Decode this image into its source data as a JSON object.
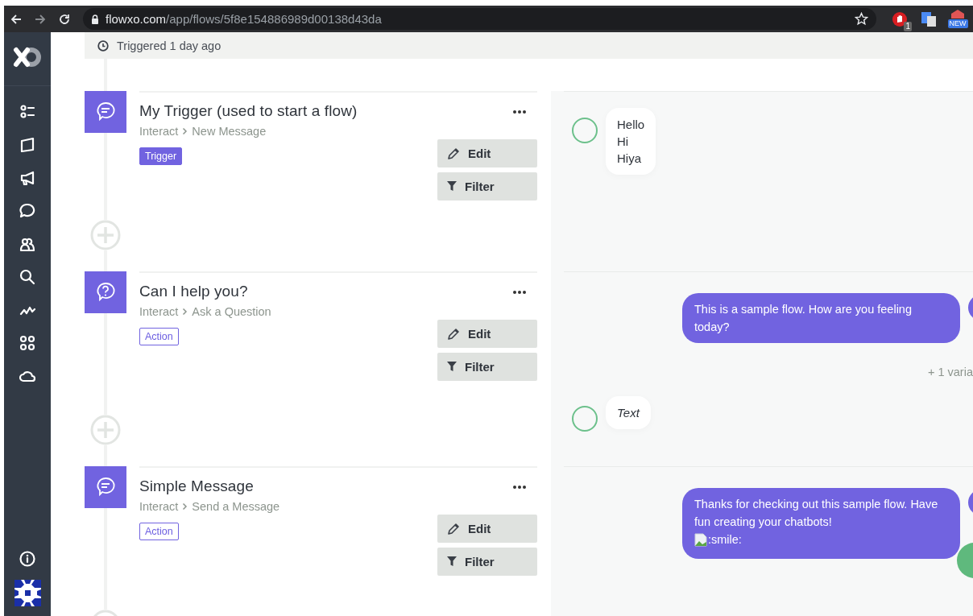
{
  "browser": {
    "url_host": "flowxo.com",
    "url_path": "/app/flows/5f8e154886989d00138d43da",
    "extension_badges": [
      {
        "text": "1",
        "kind": "count"
      },
      {
        "text": "NEW",
        "kind": "new"
      }
    ]
  },
  "header": {
    "status": "Triggered 1 day ago"
  },
  "steps": [
    {
      "kind": "trigger",
      "title": "My Trigger (used to start a flow)",
      "app": "Interact",
      "action": "New Message",
      "tag": "Trigger",
      "buttons": [
        "Edit",
        "Filter"
      ],
      "chat": [
        {
          "kind": "user_bubble",
          "lines": [
            "Hello",
            "Hi",
            "Hiya"
          ]
        }
      ]
    },
    {
      "kind": "question",
      "title": "Can I help you?",
      "app": "Interact",
      "action": "Ask a Question",
      "tag": "Action",
      "buttons": [
        "Edit",
        "Filter"
      ],
      "chat": [
        {
          "kind": "bot_bubble",
          "text": "This is a sample flow. How are you feeling today?"
        },
        {
          "kind": "note",
          "text": "+ 1 varia"
        },
        {
          "kind": "user_input",
          "text": "Text"
        }
      ]
    },
    {
      "kind": "message",
      "title": "Simple Message",
      "app": "Interact",
      "action": "Send a Message",
      "tag": "Action",
      "buttons": [
        "Edit",
        "Filter"
      ],
      "chat": [
        {
          "kind": "bot_bubble",
          "text": "Thanks for checking out this sample flow. Have fun creating your chatbots!",
          "image_alt": ":smile:"
        }
      ]
    }
  ]
}
